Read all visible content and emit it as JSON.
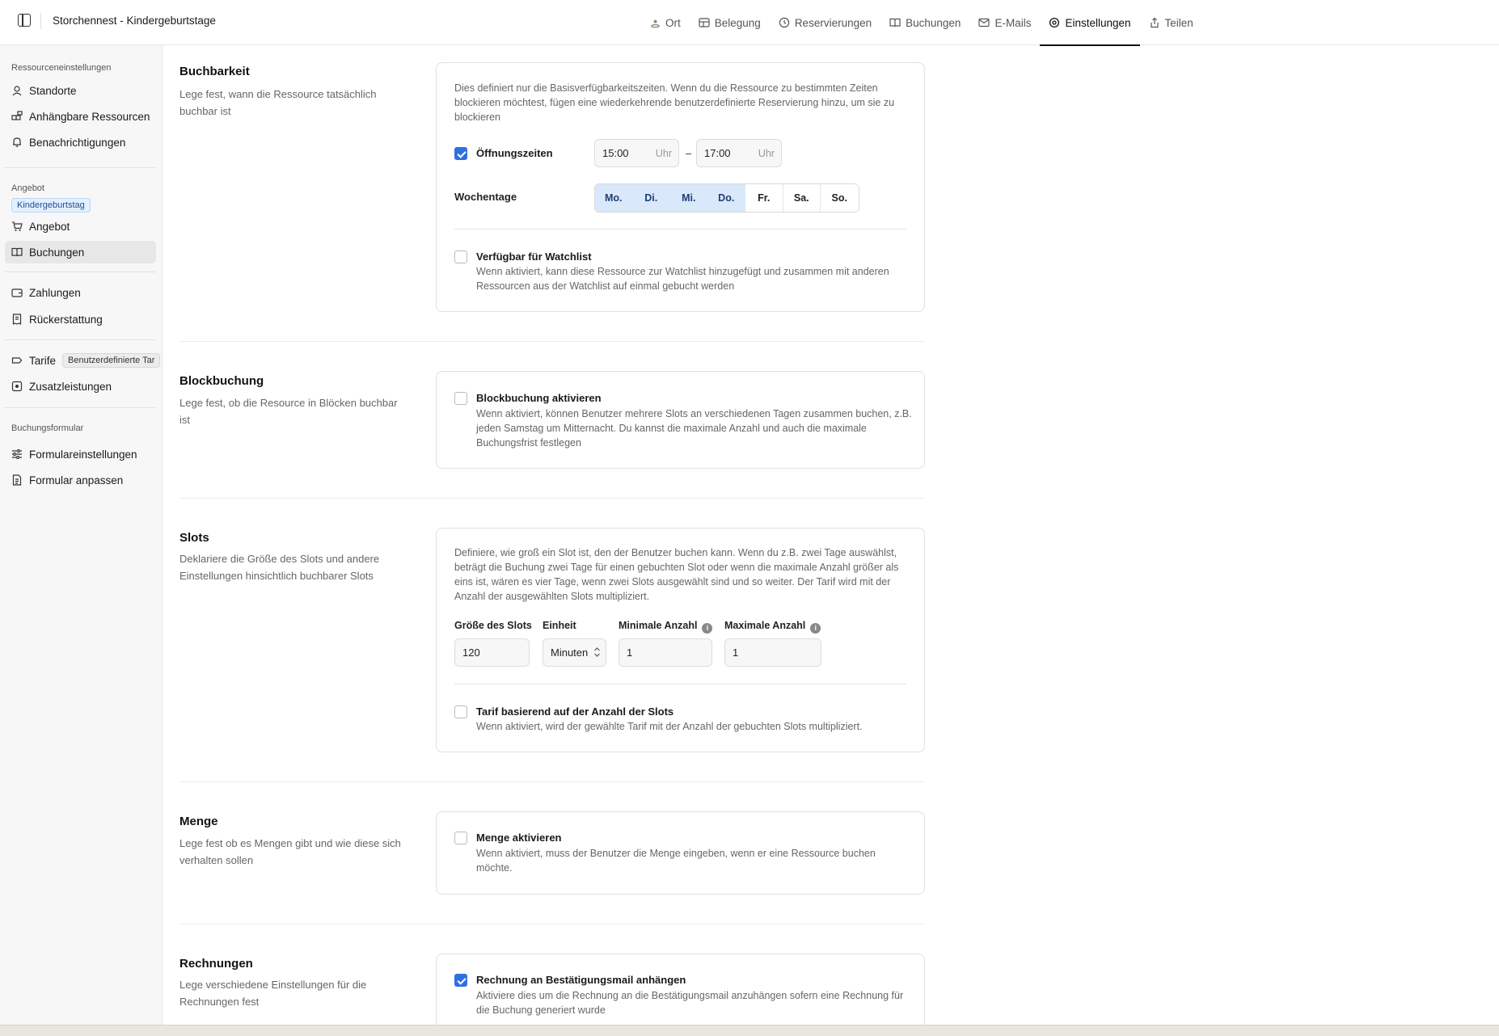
{
  "header": {
    "title": "Storchennest - Kindergeburtstage",
    "tabs": [
      {
        "label": "Ort",
        "icon": "location-icon"
      },
      {
        "label": "Belegung",
        "icon": "layout-icon"
      },
      {
        "label": "Reservierungen",
        "icon": "clock-icon"
      },
      {
        "label": "Buchungen",
        "icon": "book-icon"
      },
      {
        "label": "E-Mails",
        "icon": "mail-icon"
      },
      {
        "label": "Einstellungen",
        "icon": "gear-icon",
        "active": true
      },
      {
        "label": "Teilen",
        "icon": "share-icon"
      }
    ]
  },
  "sidebar": {
    "group_resource": "Ressourceneinstellungen",
    "standorte": "Standorte",
    "anhaengbare": "Anhängbare Ressourcen",
    "benachrichtigungen": "Benachrichtigungen",
    "group_angebot": "Angebot",
    "angebot_chip": "Kindergeburtstag",
    "angebot": "Angebot",
    "buchungen": "Buchungen",
    "zahlungen": "Zahlungen",
    "rueckerstattung": "Rückerstattung",
    "tarife": "Tarife",
    "tarife_chip": "Benutzerdefinierte Tar",
    "zusatzleistungen": "Zusatzleistungen",
    "group_form": "Buchungsformular",
    "formulareinstellungen": "Formulareinstellungen",
    "formular_anpassen": "Formular anpassen"
  },
  "buchbarkeit": {
    "title": "Buchbarkeit",
    "desc": "Lege fest, wann die Ressource tatsächlich buchbar ist",
    "info": "Dies definiert nur die Basisverfügbarkeitszeiten. Wenn du die Ressource zu bestimmten Zeiten blockieren möchtest, fügen eine wiederkehrende benutzerdefinierte Reservierung hinzu, um sie zu blockieren",
    "opening_label": "Öffnungszeiten",
    "opening_checked": true,
    "from": "15:00",
    "to": "17:00",
    "unit": "Uhr",
    "dash": "–",
    "weekdays_label": "Wochentage",
    "days": [
      {
        "label": "Mo.",
        "on": true
      },
      {
        "label": "Di.",
        "on": true
      },
      {
        "label": "Mi.",
        "on": true
      },
      {
        "label": "Do.",
        "on": true
      },
      {
        "label": "Fr.",
        "on": false
      },
      {
        "label": "Sa.",
        "on": false
      },
      {
        "label": "So.",
        "on": false
      }
    ],
    "watchlist_label": "Verfügbar für Watchlist",
    "watchlist_checked": false,
    "watchlist_desc": "Wenn aktiviert, kann diese Ressource zur Watchlist hinzugefügt und zusammen mit anderen Ressourcen aus der Watchlist auf einmal gebucht werden"
  },
  "blockbuchung": {
    "title": "Blockbuchung",
    "desc": "Lege fest, ob die Resource in Blöcken buchbar ist",
    "opt_label": "Blockbuchung aktivieren",
    "opt_checked": false,
    "opt_desc": "Wenn aktiviert, können Benutzer mehrere Slots an verschiedenen Tagen zusammen buchen, z.B. jeden Samstag um Mitternacht. Du kannst die maximale Anzahl und auch die maximale Buchungsfrist festlegen"
  },
  "slots": {
    "title": "Slots",
    "desc": "Deklariere die Größe des Slots und andere Einstellungen hinsichtlich buchbarer Slots",
    "info": "Definiere, wie groß ein Slot ist, den der Benutzer buchen kann. Wenn du z.B. zwei Tage auswählst, beträgt die Buchung zwei Tage für einen gebuchten Slot oder wenn die maximale Anzahl größer als eins ist, wären es vier Tage, wenn zwei Slots ausgewählt sind und so weiter. Der Tarif wird mit der Anzahl der ausgewählten Slots multipliziert.",
    "size_label": "Größe des Slots",
    "size_value": "120",
    "unit_label": "Einheit",
    "unit_value": "Minuten",
    "min_label": "Minimale Anzahl",
    "min_value": "1",
    "max_label": "Maximale Anzahl",
    "max_value": "1",
    "tarif_label": "Tarif basierend auf der Anzahl der Slots",
    "tarif_checked": false,
    "tarif_desc": "Wenn aktiviert, wird der gewählte Tarif mit der Anzahl der gebuchten Slots multipliziert."
  },
  "menge": {
    "title": "Menge",
    "desc": "Lege fest ob es Mengen gibt und wie diese sich verhalten sollen",
    "opt_label": "Menge aktivieren",
    "opt_checked": false,
    "opt_desc": "Wenn aktiviert, muss der Benutzer die Menge eingeben, wenn er eine Ressource buchen möchte."
  },
  "rechnungen": {
    "title": "Rechnungen",
    "desc": "Lege verschiedene Einstellungen für die Rechnungen fest",
    "opt_label": "Rechnung an Bestätigungsmail anhängen",
    "opt_checked": true,
    "opt_desc": "Aktiviere dies um die Rechnung an die Bestätigungsmail anzuhängen sofern eine Rechnung für die Buchung generiert wurde"
  },
  "colors": {
    "accent": "#2f6fe0",
    "day_on": "#d9e8fb",
    "chip": "#e3f0ff"
  }
}
